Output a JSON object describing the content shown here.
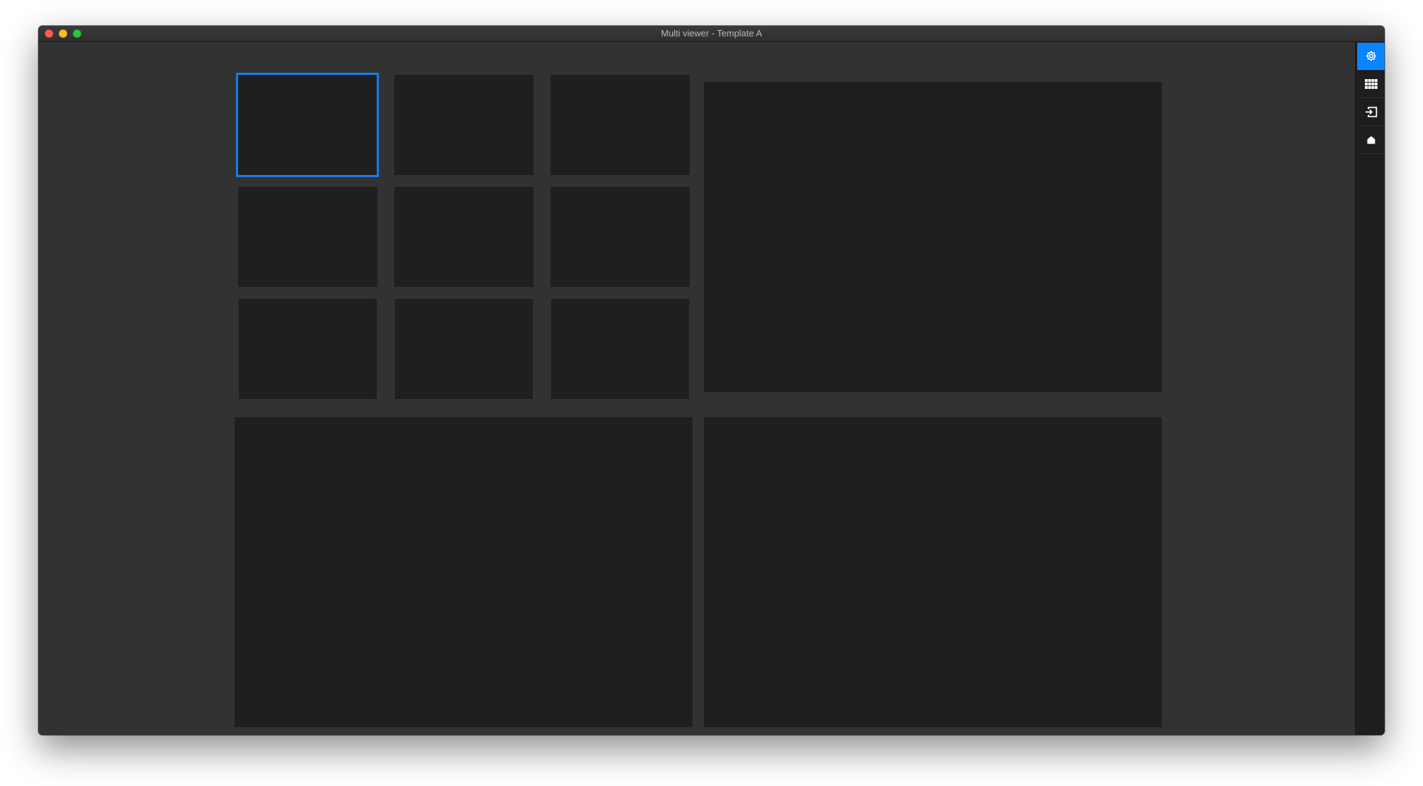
{
  "window": {
    "title": "Multi viewer - Template A"
  },
  "colors": {
    "background": "#323232",
    "tile": "#1f1f1f",
    "selection": "#1a7bf0",
    "sidebar": "#1e1e1e",
    "accent": "#0a84ff"
  },
  "tiles": [
    {
      "id": "small-1",
      "selected": true
    },
    {
      "id": "small-2",
      "selected": false
    },
    {
      "id": "small-3",
      "selected": false
    },
    {
      "id": "small-4",
      "selected": false
    },
    {
      "id": "small-5",
      "selected": false
    },
    {
      "id": "small-6",
      "selected": false
    },
    {
      "id": "small-7",
      "selected": false
    },
    {
      "id": "small-8",
      "selected": false
    },
    {
      "id": "small-9",
      "selected": false
    },
    {
      "id": "large-top-right",
      "selected": false
    },
    {
      "id": "large-bottom-left",
      "selected": false
    },
    {
      "id": "large-bottom-right",
      "selected": false
    }
  ],
  "sidebar": {
    "items": [
      {
        "icon": "gear-icon",
        "active": true
      },
      {
        "icon": "grid-icon",
        "active": false
      },
      {
        "icon": "input-icon",
        "active": false
      },
      {
        "icon": "home-icon",
        "active": false
      }
    ]
  }
}
